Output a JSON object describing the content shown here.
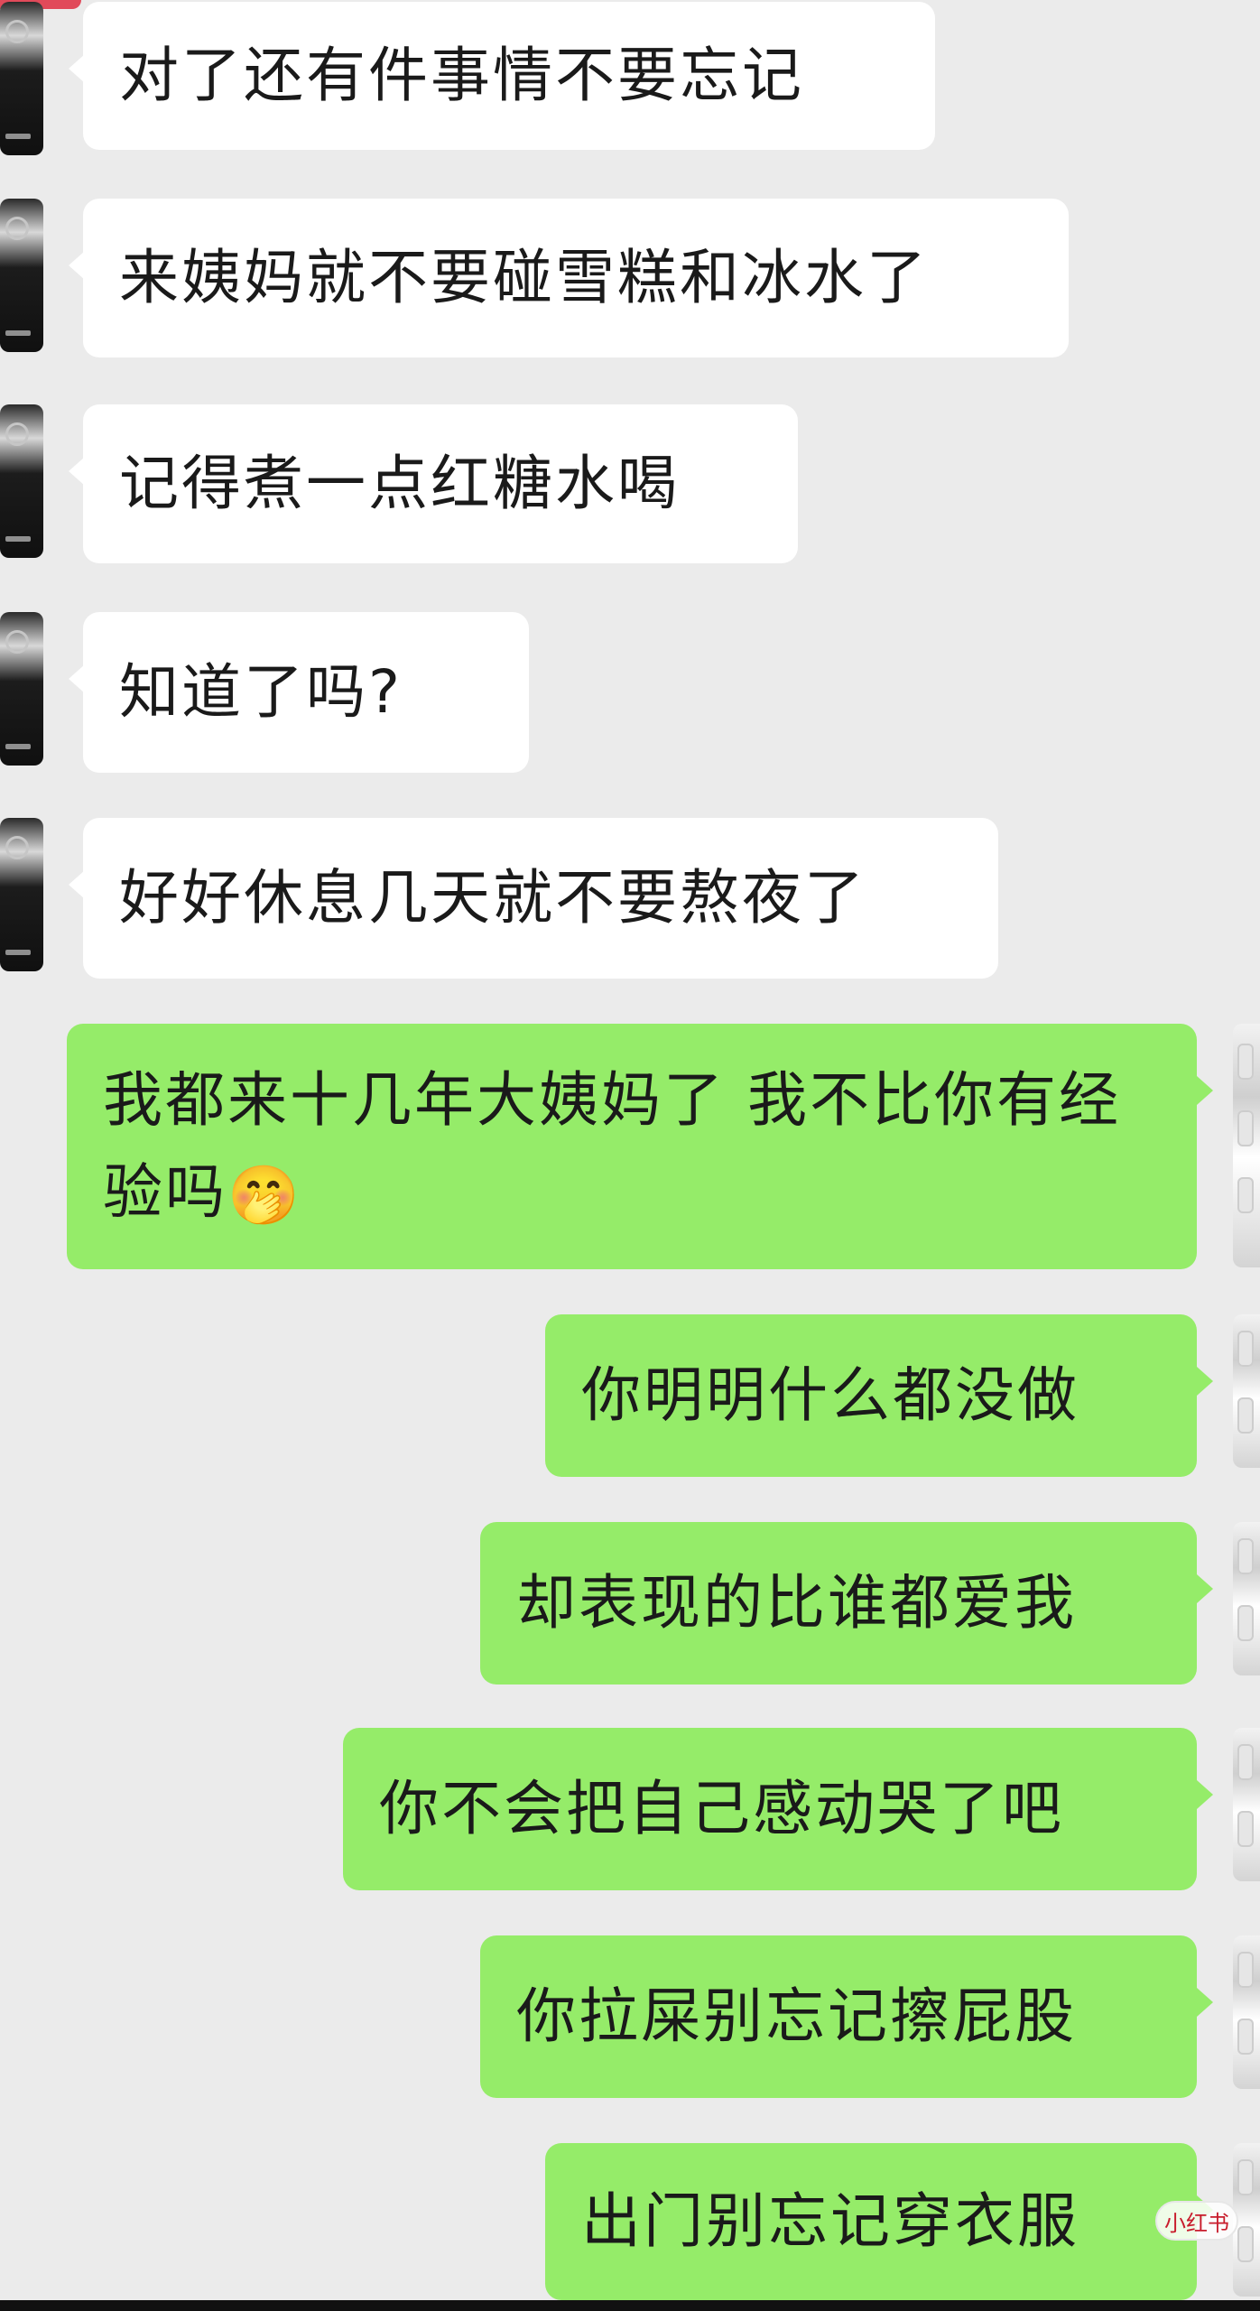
{
  "chat": {
    "messages": [
      {
        "side": "left",
        "text": "对了还有件事情不要忘记"
      },
      {
        "side": "left",
        "text": "来姨妈就不要碰雪糕和冰水了"
      },
      {
        "side": "left",
        "text": "记得煮一点红糖水喝"
      },
      {
        "side": "left",
        "text": "知道了吗?"
      },
      {
        "side": "left",
        "text": "好好休息几天就不要熬夜了"
      },
      {
        "side": "right",
        "text": "我都来十几年大姨妈了 我不比你有经验吗",
        "emoji": "🤭",
        "emoji_name": "laughing-crying-face"
      },
      {
        "side": "right",
        "text": "你明明什么都没做"
      },
      {
        "side": "right",
        "text": "却表现的比谁都爱我"
      },
      {
        "side": "right",
        "text": "你不会把自己感动哭了吧"
      },
      {
        "side": "right",
        "text": "你拉屎别忘记擦屁股"
      },
      {
        "side": "right",
        "text": "出门别忘记穿衣服"
      }
    ]
  },
  "watermark": {
    "text": "小红书"
  },
  "colors": {
    "background": "#ebebeb",
    "incoming_bubble": "#ffffff",
    "outgoing_bubble": "#95ec69",
    "text": "#1a1a1a",
    "watermark_text": "#c81c2c"
  }
}
